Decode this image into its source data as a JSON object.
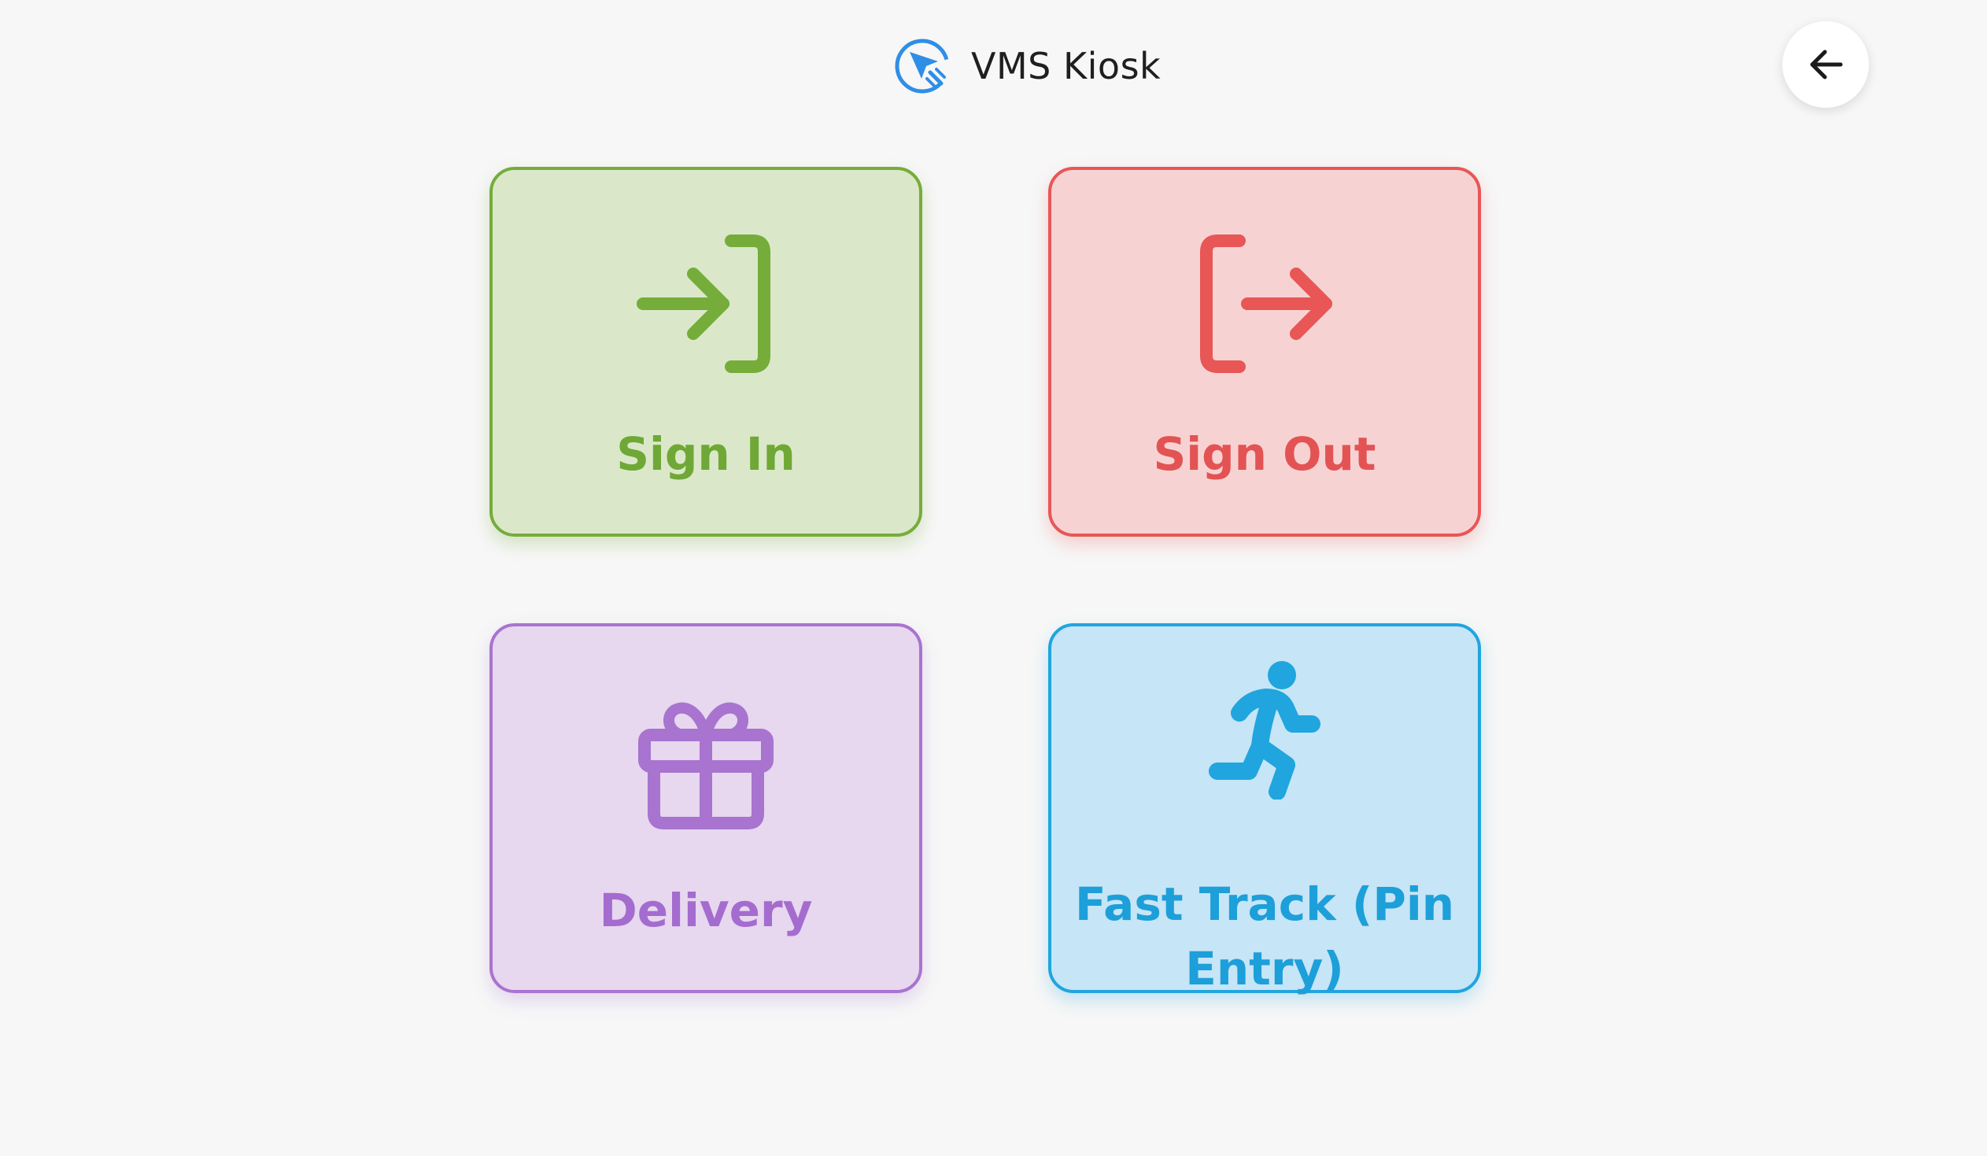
{
  "header": {
    "app_name": "VMS Kiosk",
    "logo_icon": "cursor-click-icon",
    "back_icon": "arrow-left-icon"
  },
  "tiles": [
    {
      "label": "Sign In",
      "icon": "sign-in-icon",
      "color": "#76ac3a",
      "background": "#dae8c9"
    },
    {
      "label": "Sign Out",
      "icon": "sign-out-icon",
      "color": "#e85656",
      "background": "#f7d2d3"
    },
    {
      "label": "Delivery",
      "icon": "gift-icon",
      "color": "#a874cf",
      "background": "#e7d7ef"
    },
    {
      "label": "Fast Track (Pin Entry)",
      "icon": "running-person-icon",
      "color": "#20a5de",
      "background": "#c6e5f6"
    }
  ],
  "colors": {
    "page_background": "#f7f7f7",
    "brand_accent": "#2f8ee6"
  }
}
